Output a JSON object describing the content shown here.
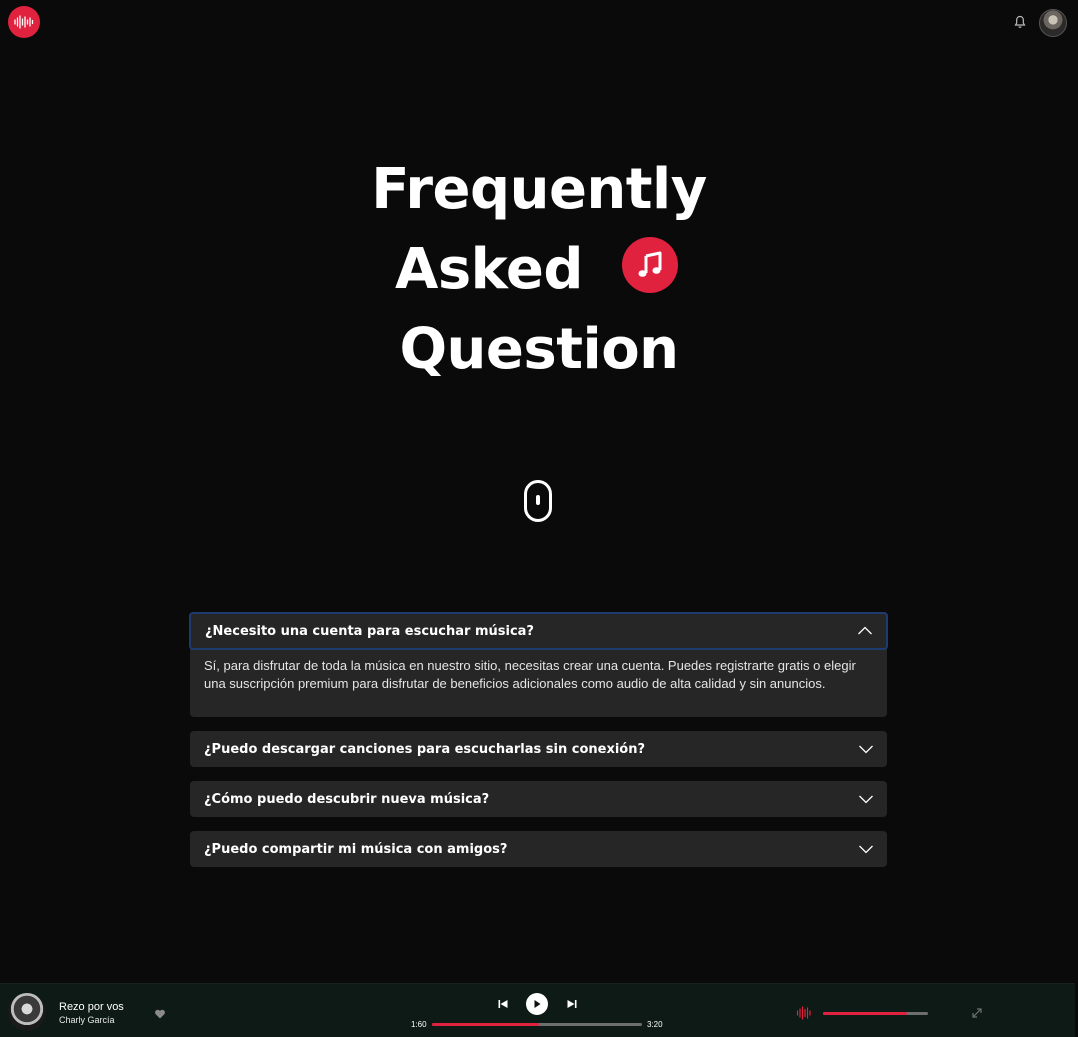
{
  "header": {
    "logo_icon": "soundwave-logo-icon",
    "notification_icon": "bell-icon",
    "avatar_icon": "user-avatar"
  },
  "hero": {
    "line1": "Frequently",
    "line2": "Asked",
    "line3": "Question",
    "badge_icon": "music-note-icon",
    "scroll_icon": "mouse-scroll-icon"
  },
  "faq": {
    "items": [
      {
        "question": "¿Necesito una cuenta para escuchar música?",
        "answer": "Sí, para disfrutar de toda la música en nuestro sitio, necesitas crear una cuenta. Puedes registrarte gratis o elegir una suscripción premium para disfrutar de beneficios adicionales como audio de alta calidad y sin anuncios.",
        "expanded": true
      },
      {
        "question": "¿Puedo descargar canciones para escucharlas sin conexión?",
        "expanded": false
      },
      {
        "question": "¿Cómo puedo descubrir nueva música?",
        "expanded": false
      },
      {
        "question": "¿Puedo compartir mi música con amigos?",
        "expanded": false
      }
    ]
  },
  "player": {
    "song_title": "Rezo por vos",
    "artist": "Charly García",
    "current_time": "1:60",
    "total_time": "3:20",
    "progress_fraction": 0.51,
    "volume_fraction": 0.8
  },
  "colors": {
    "accent": "#e0223f",
    "background": "#0a0a0a",
    "card": "#262626",
    "player_bg": "#0d1a16"
  }
}
